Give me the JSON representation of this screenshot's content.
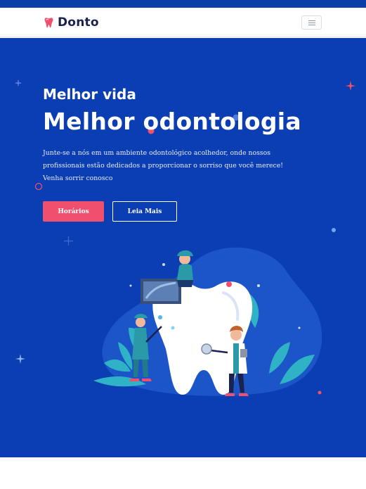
{
  "nav": {
    "brand": "Donto",
    "brand_icon": "tooth-icon",
    "menu_icon": "hamburger-menu-icon"
  },
  "hero": {
    "subtitle": "Melhor vida",
    "title": "Melhor odontologia",
    "text_lines": [
      "Junte-se a nós em um ambiente odontológico acolhedor, onde nossos",
      "profissionais estão dedicados a proporcionar o sorriso que você merece!",
      "Venha sorrir conosco"
    ],
    "primary_button": "Horários",
    "secondary_button": "Leia Mais",
    "illustration": "dentists-cleaning-tooth-illustration"
  },
  "colors": {
    "brand_blue": "#0c3eb3",
    "accent_pink": "#f0506e",
    "navy": "#1a2350"
  }
}
